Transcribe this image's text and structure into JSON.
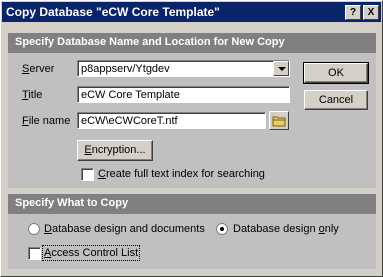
{
  "window": {
    "title": "Copy Database \"eCW Core Template\"",
    "help_glyph": "?",
    "close_glyph": "X"
  },
  "section1": {
    "header": "Specify Database Name and Location for New Copy",
    "server": {
      "label_u": "S",
      "label_rest": "erver",
      "value": "p8appserv/Ytgdev"
    },
    "title": {
      "label_u": "T",
      "label_rest": "itle",
      "value": "eCW Core Template"
    },
    "filename": {
      "label_u": "F",
      "label_rest": "ile name",
      "value": "eCW\\eCWCoreT.ntf"
    },
    "encryption": {
      "label_u": "E",
      "label_rest": "ncryption..."
    },
    "fulltext": {
      "label_u": "C",
      "label_rest": "reate full text index for searching",
      "checked": false
    }
  },
  "buttons": {
    "ok": "OK",
    "cancel": "Cancel"
  },
  "section2": {
    "header": "Specify What to Copy",
    "option1": {
      "label_u": "D",
      "label_rest": "atabase design and documents",
      "selected": false
    },
    "option2": {
      "label_pre": "Database design ",
      "label_u": "o",
      "label_rest": "nly",
      "selected": true
    },
    "acl": {
      "label_u": "A",
      "label_rest": "ccess Control List",
      "checked": false
    }
  },
  "icons": {
    "folder": "folder-icon"
  }
}
